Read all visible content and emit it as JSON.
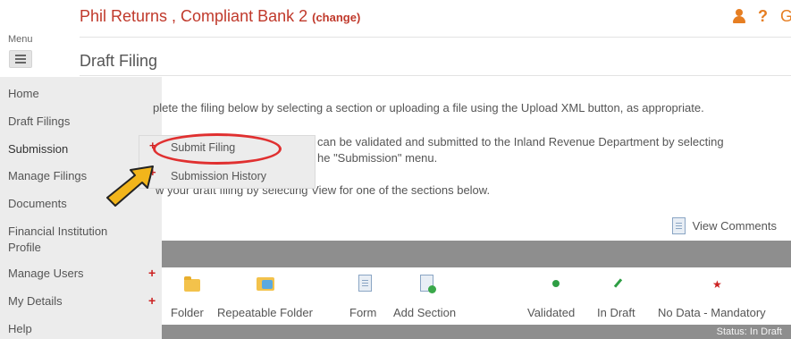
{
  "header": {
    "title": "Phil Returns , Compliant Bank 2 ",
    "change_link": "(change)",
    "icons": [
      "user-icon",
      "help-icon",
      "logout-icon"
    ],
    "help_glyph": "?",
    "logout_glyph": "G"
  },
  "menu": {
    "label": "Menu",
    "items": [
      {
        "label": "Home",
        "has_plus": false
      },
      {
        "label": "Draft Filings",
        "has_plus": false
      },
      {
        "label": "Submission",
        "has_plus": false,
        "active": true
      },
      {
        "label": "Manage Filings",
        "has_plus": false
      },
      {
        "label": "Documents",
        "has_plus": false
      },
      {
        "label": "Financial Institution Profile",
        "has_plus": false
      },
      {
        "label": "Manage Users",
        "has_plus": true
      },
      {
        "label": "My Details",
        "has_plus": true
      },
      {
        "label": "Help",
        "has_plus": false
      }
    ],
    "plus_glyph": "+"
  },
  "page": {
    "title": "Draft Filing",
    "instructions": [
      "plete the filing below by selecting a section or uploading a file using the Upload XML button, as appropriate.",
      "can be validated and submitted to the Inland Revenue Department by selecting",
      "he \"Submission\" menu.",
      "w your draft filing by selecting View for one of the sections below."
    ],
    "view_comments": "View Comments"
  },
  "submission_submenu": {
    "items": [
      {
        "label": "Submit Filing"
      },
      {
        "label": "Submission History"
      }
    ]
  },
  "legend": {
    "items": [
      {
        "label": "Folder",
        "icon": "folder-icon"
      },
      {
        "label": "Repeatable Folder",
        "icon": "repeatable-folder-icon"
      },
      {
        "label": "Form",
        "icon": "form-icon"
      },
      {
        "label": "Add Section",
        "icon": "add-section-icon"
      },
      {
        "label": "Validated",
        "icon": "validated-icon"
      },
      {
        "label": "In Draft",
        "icon": "in-draft-icon"
      },
      {
        "label": "No Data - Mandatory",
        "icon": "mandatory-star-icon"
      }
    ]
  },
  "status": {
    "text": "Status: In Draft"
  },
  "colors": {
    "brand_red": "#c0392b",
    "accent_orange": "#e67e22",
    "sidebar_bg": "#ececec",
    "bar_grey": "#8e8e8e",
    "highlight_red": "#e03030",
    "arrow_yellow": "#f2b51b"
  }
}
